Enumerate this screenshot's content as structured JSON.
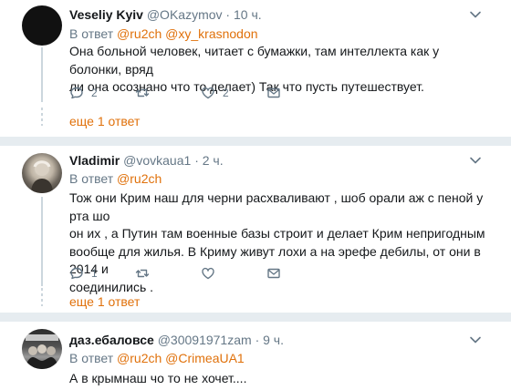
{
  "tweets": [
    {
      "name": "Veseliy Kyiv",
      "handle": "@OKazymov",
      "sep": "·",
      "time": "10 ч.",
      "reply_prefix": "В ответ",
      "mentions": [
        "@ru2ch",
        "@xy_krasnodon"
      ],
      "lines": [
        "Она больной человек, читает с бумажки, там интеллекта как у болонки, вряд",
        "ли она осознано что то делает) Так что пусть путешествует."
      ],
      "reply_count": "2",
      "retweet_count": "",
      "like_count": "2",
      "more_label": "еще 1 ответ",
      "avatar_icon": "user-avatar-black"
    },
    {
      "name": "Vladimir",
      "handle": "@vovkaua1",
      "sep": "·",
      "time": "2 ч.",
      "reply_prefix": "В ответ",
      "mentions": [
        "@ru2ch"
      ],
      "lines": [
        "Тож они Крим наш для черни расхваливают , шоб орали аж с пеной у рта шо",
        "он их , а Путин там военные базы строит и делает Крим непригодным",
        "вообще для жилья. В Криму живут лохи а на эрефе дебилы, от они в 2014 и",
        "соединились ."
      ],
      "reply_count": "1",
      "retweet_count": "",
      "like_count": "",
      "more_label": "еще 1 ответ",
      "avatar_icon": "user-avatar-photo"
    },
    {
      "name": "даз.ебаловсе",
      "handle": "@30091971zam",
      "sep": "·",
      "time": "9 ч.",
      "reply_prefix": "В ответ",
      "mentions": [
        "@ru2ch",
        "@CrimeaUA1"
      ],
      "lines": [
        "А в крымнаш чо то не хочет...."
      ],
      "avatar_icon": "user-avatar-group"
    }
  ],
  "colors": {
    "accent": "#e0710b",
    "muted": "#657786",
    "text": "#14171a",
    "divider": "#e6ecf0"
  }
}
